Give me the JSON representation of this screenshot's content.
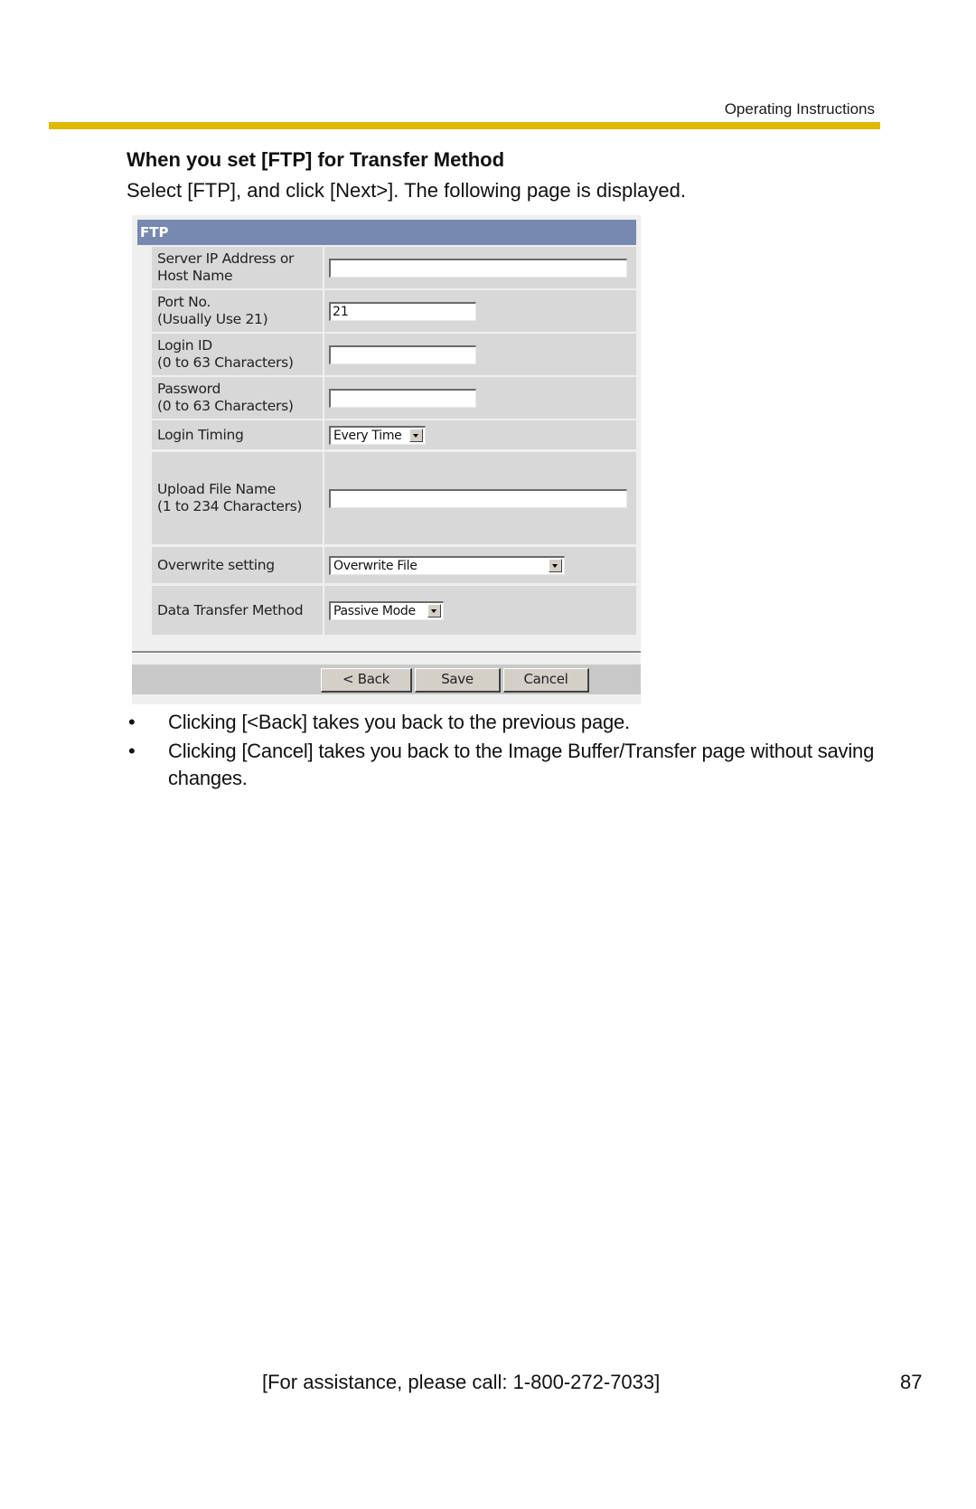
{
  "header": {
    "running_head": "Operating Instructions",
    "rule_color": "#e0b800"
  },
  "section": {
    "title": "When you set [FTP] for Transfer Method",
    "intro": "Select [FTP], and click [Next>]. The following page is displayed."
  },
  "ftp_form": {
    "header": "FTP",
    "header_color": "#7789b0",
    "fields": [
      {
        "label": "Server IP Address or\nHost Name",
        "type": "text",
        "value": ""
      },
      {
        "label": "Port No.\n(Usually Use 21)",
        "type": "text",
        "value": "21"
      },
      {
        "label": "Login ID\n(0 to 63 Characters)",
        "type": "text",
        "value": ""
      },
      {
        "label": "Password\n(0 to 63 Characters)",
        "type": "password",
        "value": ""
      },
      {
        "label": "Login Timing",
        "type": "select",
        "value": "Every Time"
      },
      {
        "label": "Upload File Name\n(1 to 234 Characters)",
        "type": "text",
        "value": ""
      },
      {
        "label": "Overwrite setting",
        "type": "select",
        "value": "Overwrite File"
      },
      {
        "label": "Data Transfer Method",
        "type": "select",
        "value": "Passive Mode"
      }
    ],
    "buttons": {
      "back": "< Back",
      "save": "Save",
      "cancel": "Cancel"
    }
  },
  "bullets": [
    {
      "symbol": "•",
      "text": "Clicking [<Back] takes you back to the previous page."
    },
    {
      "symbol": "•",
      "text": "Clicking [Cancel] takes you back to the Image Buffer/Transfer page without saving changes."
    }
  ],
  "footer": {
    "assistance": "[For assistance, please call: 1-800-272-7033]",
    "page_number": "87"
  }
}
